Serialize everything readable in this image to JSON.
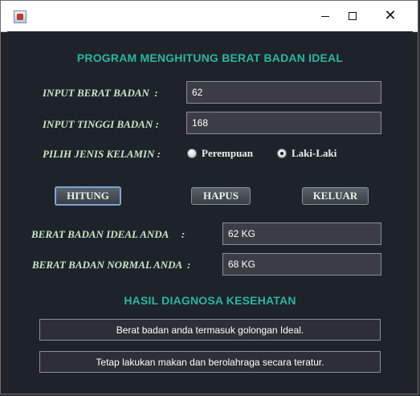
{
  "window": {
    "title": "",
    "icon": "java-app-icon"
  },
  "heading": "PROGRAM MENGHITUNG BERAT BADAN IDEAL",
  "form": {
    "weight_label": "INPUT BERAT BADAN  :",
    "weight_value": "62",
    "height_label": "INPUT TINGGI BADAN :",
    "height_value": "168",
    "gender_label": "PILIH JENIS KELAMIN :",
    "gender_options": [
      "Perempuan",
      "Laki-Laki"
    ],
    "gender_selected": "Laki-Laki"
  },
  "buttons": {
    "calculate": "HITUNG",
    "clear": "HAPUS",
    "exit": "KELUAR"
  },
  "results": {
    "ideal_label": "BERAT BADAN IDEAL ANDA     :",
    "ideal_value": "62 KG",
    "normal_label": "BERAT BADAN NORMAL ANDA  :",
    "normal_value": "68 KG"
  },
  "diagnosis": {
    "heading": "HASIL DIAGNOSA KESEHATAN",
    "message1": "Berat badan anda termasuk golongan Ideal.",
    "message2": "Tetap lakukan makan dan berolahraga secara teratur."
  }
}
